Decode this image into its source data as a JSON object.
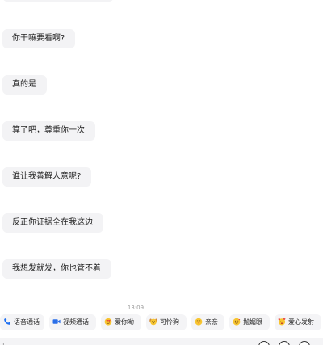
{
  "messages": [
    {
      "text": "你干嘛要看啊?"
    },
    {
      "text": "真的是"
    },
    {
      "text": "算了吧，尊重你一次"
    },
    {
      "text": "谁让我善解人意呢?"
    },
    {
      "text": "反正你证据全在我这边"
    },
    {
      "text": "我想发就发，你也管不着"
    }
  ],
  "timestamp": "13:09",
  "quick_actions": [
    {
      "label": "语音通话",
      "icon": "phone-icon"
    },
    {
      "label": "视频通话",
      "icon": "video-camera-icon"
    },
    {
      "label": "爱你呦",
      "icon": "heart-eyes-emoji-icon"
    },
    {
      "label": "可怜狗",
      "icon": "puppy-emoji-icon"
    },
    {
      "label": "亲亲",
      "icon": "kiss-emoji-icon"
    },
    {
      "label": "抛媚眼",
      "icon": "wink-emoji-icon"
    },
    {
      "label": "爱心发射",
      "icon": "heart-launch-emoji-icon"
    }
  ],
  "bottom": {
    "input_stub": "ㄱ"
  },
  "colors": {
    "bubble_bg": "#f3f3f5",
    "chip_bg": "#f4f4f6",
    "phone_blue": "#1e6ff1",
    "video_blue": "#2b6fe8",
    "emoji_yellow": "#f7c531",
    "emoji_red": "#e8403a"
  }
}
